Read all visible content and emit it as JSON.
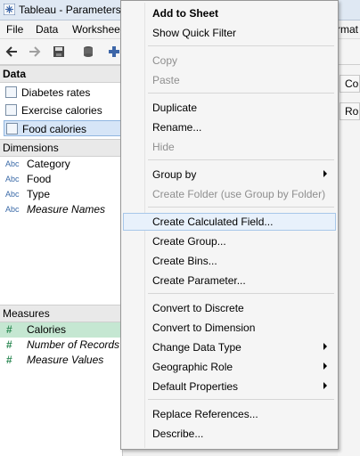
{
  "window": {
    "title": "Tableau - Parameters"
  },
  "menubar": {
    "items": [
      "File",
      "Data",
      "Worksheet",
      "rmat"
    ]
  },
  "data_pane": {
    "header": "Data",
    "sources": [
      "Diabetes rates",
      "Exercise calories",
      "Food calories"
    ],
    "selected_source": "Food calories"
  },
  "dimensions": {
    "header": "Dimensions",
    "type_label": "Abc",
    "fields": [
      "Category",
      "Food",
      "Type",
      "Measure Names"
    ]
  },
  "measures": {
    "header": "Measures",
    "hash_label": "#",
    "fields": [
      "Calories",
      "Number of Records",
      "Measure Values"
    ]
  },
  "right_fragments": {
    "top": "Co",
    "bottom": "Ro"
  },
  "context_menu": {
    "items": [
      {
        "label": "Add to Sheet"
      },
      {
        "label": "Show Quick Filter"
      },
      {
        "label": "Copy"
      },
      {
        "label": "Paste"
      },
      {
        "label": "Duplicate"
      },
      {
        "label": "Rename..."
      },
      {
        "label": "Hide"
      },
      {
        "label": "Group by"
      },
      {
        "label": "Create Folder (use Group by Folder)"
      },
      {
        "label": "Create Calculated Field..."
      },
      {
        "label": "Create Group..."
      },
      {
        "label": "Create Bins..."
      },
      {
        "label": "Create Parameter..."
      },
      {
        "label": "Convert to Discrete"
      },
      {
        "label": "Convert to Dimension"
      },
      {
        "label": "Change Data Type"
      },
      {
        "label": "Geographic Role"
      },
      {
        "label": "Default Properties"
      },
      {
        "label": "Replace References..."
      },
      {
        "label": "Describe..."
      }
    ]
  },
  "colors": {
    "menu_hover": "#e8f1fb",
    "measure_highlight": "#c5e7d2",
    "selected_source": "#d6e5f7"
  }
}
